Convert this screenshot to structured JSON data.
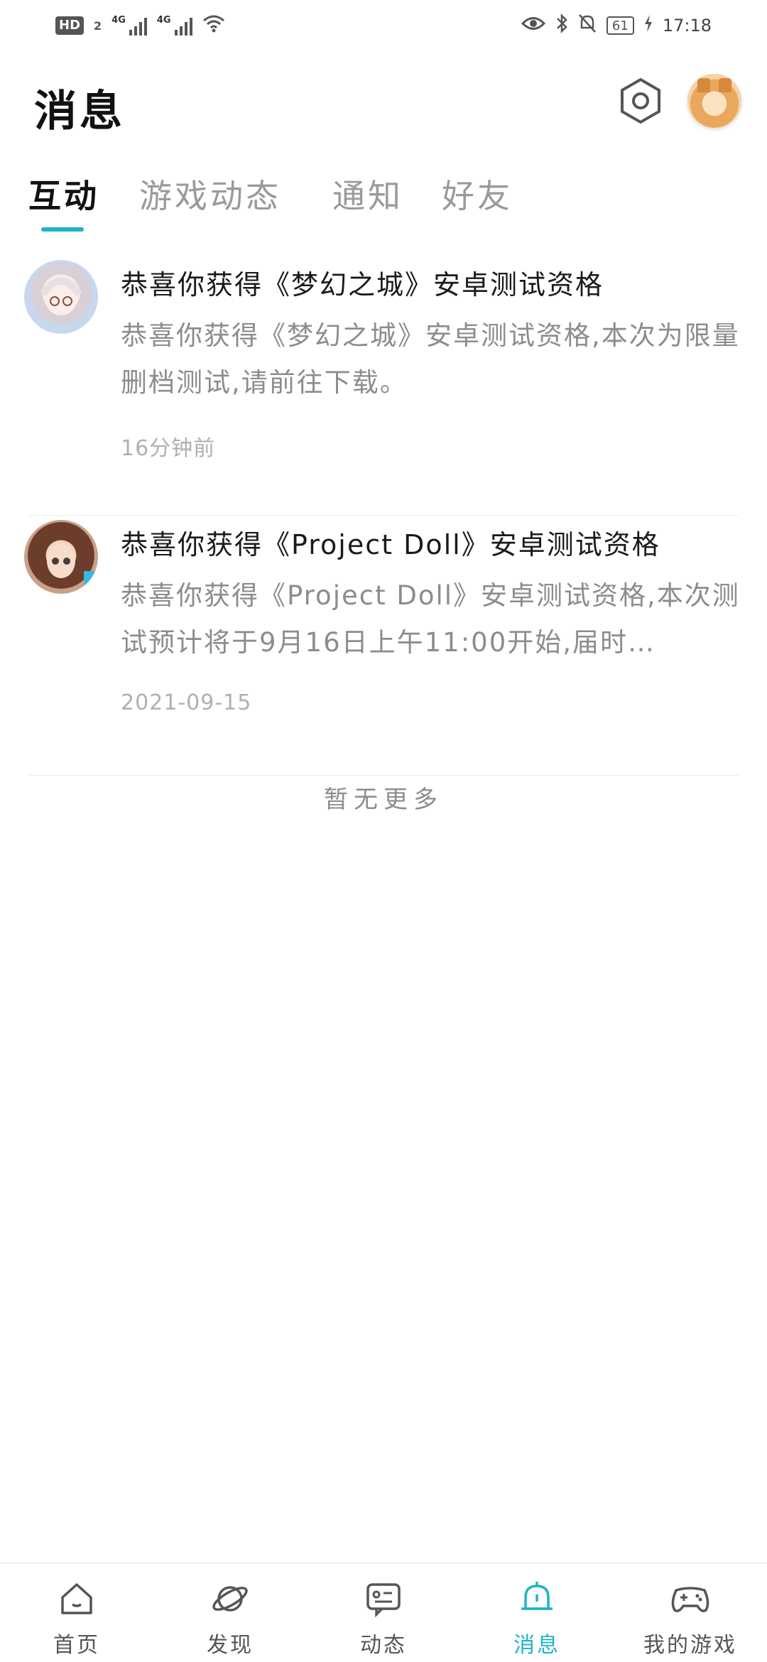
{
  "status_bar": {
    "hd": "HD",
    "sim": "2",
    "net1": "4G",
    "net2": "4G",
    "battery": "61",
    "time": "17:18"
  },
  "header": {
    "title": "消息"
  },
  "tabs": [
    {
      "label": "互动",
      "active": true
    },
    {
      "label": "游戏动态",
      "active": false
    },
    {
      "label": "通知",
      "active": false
    },
    {
      "label": "好友",
      "active": false
    }
  ],
  "messages": [
    {
      "title": "恭喜你获得《梦幻之城》安卓测试资格",
      "body": "恭喜你获得《梦幻之城》安卓测试资格,本次为限量删档测试,请前往下载。",
      "time": "16分钟前"
    },
    {
      "title": "恭喜你获得《Project Doll》安卓测试资格",
      "body": "恭喜你获得《Project Doll》安卓测试资格,本次测试预计将于9月16日上午11:00开始,届时…",
      "time": "2021-09-15"
    }
  ],
  "list_footer": "暂无更多",
  "bottom_nav": [
    {
      "label": "首页",
      "icon": "home-icon",
      "active": false
    },
    {
      "label": "发现",
      "icon": "planet-icon",
      "active": false
    },
    {
      "label": "动态",
      "icon": "feed-icon",
      "active": false
    },
    {
      "label": "消息",
      "icon": "bell-icon",
      "active": true
    },
    {
      "label": "我的游戏",
      "icon": "gamepad-icon",
      "active": false
    }
  ],
  "colors": {
    "accent": "#1fb4c4",
    "text_primary": "#1a1a1a",
    "text_secondary": "#8c8c8c"
  }
}
